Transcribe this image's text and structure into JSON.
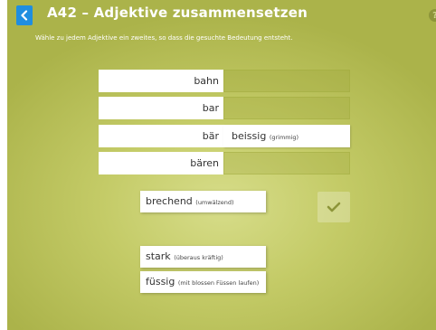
{
  "header": {
    "title": "A42 – Adjektive zusammensetzen",
    "instruction": "Wähle zu jedem Adjektive ein zweites, so dass die gesuchte Bedeutung entsteht."
  },
  "rows": [
    {
      "word": "bahn",
      "answer": null,
      "gloss": null
    },
    {
      "word": "bar",
      "answer": null,
      "gloss": null
    },
    {
      "word": "bär",
      "answer": "beissig",
      "gloss": "(grimmig)"
    },
    {
      "word": "bären",
      "answer": null,
      "gloss": null
    }
  ],
  "tiles": [
    {
      "word": "brechend",
      "gloss": "(umwälzend)"
    },
    {
      "word": "stark",
      "gloss": "(überaus kräftig)"
    },
    {
      "word": "füssig",
      "gloss": "(mit blossen Füssen laufen)"
    }
  ],
  "icons": {
    "back": "chevron-left-icon",
    "help": "help-icon",
    "check": "checkmark-icon"
  },
  "help_glyph": "?",
  "colors": {
    "background": "#c4cb67",
    "accent_blue": "#1f8ee0",
    "check": "#8d9539"
  }
}
